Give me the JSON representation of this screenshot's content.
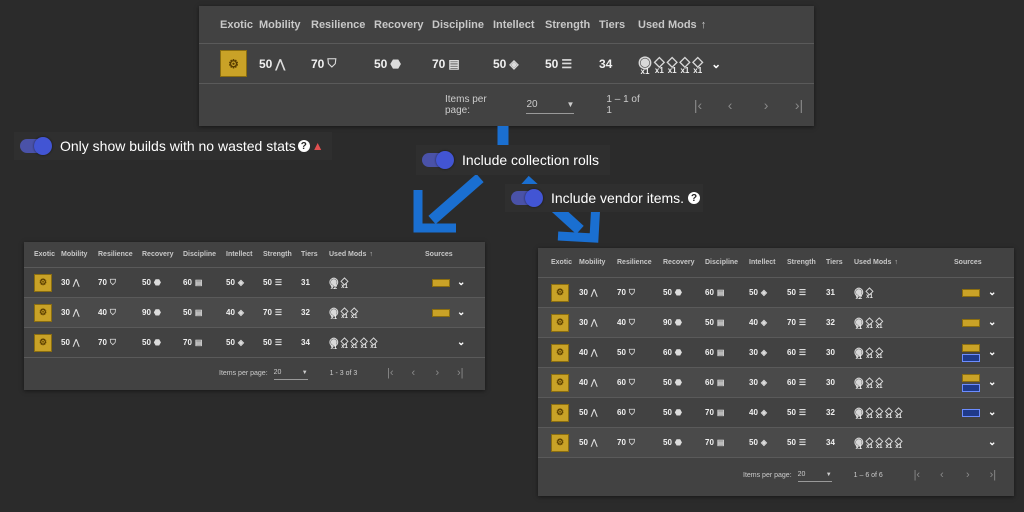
{
  "columns": {
    "exotic": "Exotic",
    "mobility": "Mobility",
    "resilience": "Resilience",
    "recovery": "Recovery",
    "discipline": "Discipline",
    "intellect": "Intellect",
    "strength": "Strength",
    "tiers": "Tiers",
    "used_mods": "Used Mods",
    "sort_icon": "↑",
    "sources": "Sources"
  },
  "pagination": {
    "label": "Items per page:",
    "value": "20",
    "top_range": "1 – 1 of 1",
    "left_range": "1 - 3 of 3",
    "right_range": "1 – 6 of 6"
  },
  "toggles": {
    "no_wasted": "Only show builds with no wasted stats",
    "collection": "Include collection rolls",
    "vendor": "Include vendor items."
  },
  "top": {
    "rows": [
      {
        "mob": "50",
        "res": "70",
        "rec": "50",
        "dis": "70",
        "int": "50",
        "str": "50",
        "tiers": "34",
        "mods": [
          "x1",
          "x1",
          "x1",
          "x1",
          "x1"
        ]
      }
    ]
  },
  "left": {
    "rows": [
      {
        "mob": "30",
        "res": "70",
        "rec": "50",
        "dis": "60",
        "int": "50",
        "str": "50",
        "tiers": "31",
        "mods": [
          "x2",
          "x1"
        ]
      },
      {
        "mob": "30",
        "res": "40",
        "rec": "90",
        "dis": "50",
        "int": "40",
        "str": "70",
        "tiers": "32",
        "mods": [
          "x1",
          "x1",
          "x1"
        ]
      },
      {
        "mob": "50",
        "res": "70",
        "rec": "50",
        "dis": "70",
        "int": "50",
        "str": "50",
        "tiers": "34",
        "mods": [
          "x1",
          "x1",
          "x1",
          "x1",
          "x1"
        ]
      }
    ]
  },
  "right": {
    "rows": [
      {
        "mob": "30",
        "res": "70",
        "rec": "50",
        "dis": "60",
        "int": "50",
        "str": "50",
        "tiers": "31",
        "mods": [
          "x2",
          "x1"
        ]
      },
      {
        "mob": "30",
        "res": "40",
        "rec": "90",
        "dis": "50",
        "int": "40",
        "str": "70",
        "tiers": "32",
        "mods": [
          "x1",
          "x1",
          "x1"
        ]
      },
      {
        "mob": "40",
        "res": "50",
        "rec": "60",
        "dis": "60",
        "int": "30",
        "str": "60",
        "tiers": "30",
        "mods": [
          "x1",
          "x1",
          "x1"
        ]
      },
      {
        "mob": "40",
        "res": "60",
        "rec": "50",
        "dis": "60",
        "int": "30",
        "str": "60",
        "tiers": "30",
        "mods": [
          "x1",
          "x1",
          "x1"
        ]
      },
      {
        "mob": "50",
        "res": "60",
        "rec": "50",
        "dis": "70",
        "int": "40",
        "str": "50",
        "tiers": "32",
        "mods": [
          "x1",
          "x1",
          "x1",
          "x1",
          "x1"
        ]
      },
      {
        "mob": "50",
        "res": "70",
        "rec": "50",
        "dis": "70",
        "int": "50",
        "str": "50",
        "tiers": "34",
        "mods": [
          "x1",
          "x1",
          "x1",
          "x1",
          "x1"
        ]
      }
    ]
  },
  "accent": "#1a6fd1"
}
